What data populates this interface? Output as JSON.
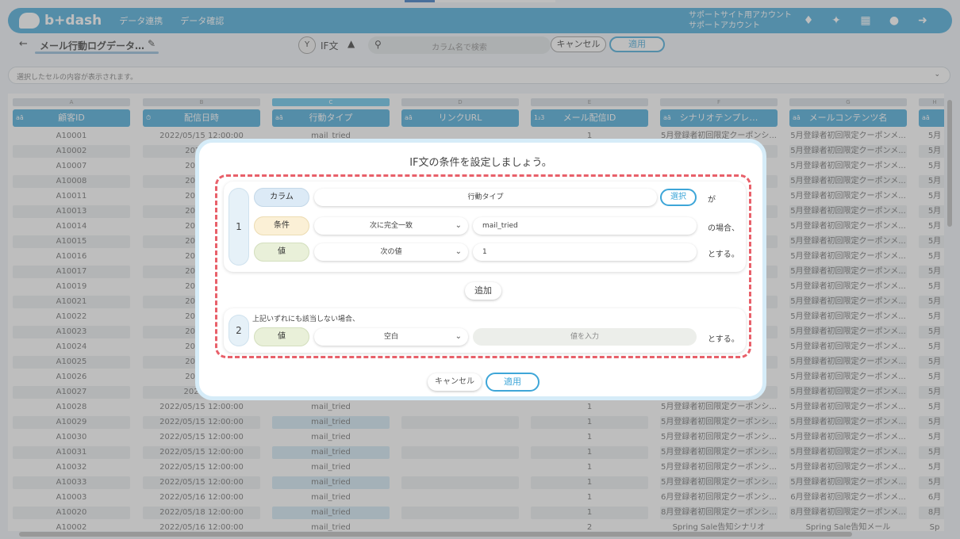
{
  "app": {
    "brand": "b+dash",
    "nav": [
      "データ連携",
      "データ確認"
    ],
    "account_line1": "サポートサイト用アカウント",
    "account_line2": "サポートアカウント",
    "accent": "#3ea6d8"
  },
  "toolbar": {
    "back": "←",
    "doc_title": "メール行動ログデータ…",
    "if_label": "IF文",
    "search_placeholder": "カラム名で検索",
    "cancel": "キャンセル",
    "apply": "適用"
  },
  "cellbar": {
    "text": "選択したセルの内容が表示されます。",
    "chevron": "⌄"
  },
  "grid": {
    "columns": [
      {
        "letter": "A",
        "type": "aā",
        "name": "顧客ID"
      },
      {
        "letter": "B",
        "type": "⏱",
        "name": "配信日時"
      },
      {
        "letter": "C",
        "type": "aā",
        "name": "行動タイプ"
      },
      {
        "letter": "D",
        "type": "aā",
        "name": "リンクURL"
      },
      {
        "letter": "E",
        "type": "1₂3",
        "name": "メール配信ID"
      },
      {
        "letter": "F",
        "type": "aā",
        "name": "シナリオテンプレ…"
      },
      {
        "letter": "G",
        "type": "aā",
        "name": "メールコンテンツ名"
      },
      {
        "letter": "H",
        "type": "aā",
        "name": ""
      }
    ],
    "rows": [
      [
        "A10001",
        "2022/05/15 12:00:00",
        "mail_tried",
        "",
        "1",
        "5月登録者初回限定クーポンシ...",
        "5月登録者初回限定クーポンメ...",
        "5月"
      ],
      [
        "A10002",
        "2022/05",
        "",
        "",
        "",
        "...",
        "5月登録者初回限定クーポンメ...",
        "5月"
      ],
      [
        "A10007",
        "2022/05",
        "",
        "",
        "",
        "...",
        "5月登録者初回限定クーポンメ...",
        "5月"
      ],
      [
        "A10008",
        "2022/05",
        "",
        "",
        "",
        "...",
        "5月登録者初回限定クーポンメ...",
        "5月"
      ],
      [
        "A10011",
        "2022/05",
        "",
        "",
        "",
        "...",
        "5月登録者初回限定クーポンメ...",
        "5月"
      ],
      [
        "A10013",
        "2022/05",
        "",
        "",
        "",
        "...",
        "5月登録者初回限定クーポンメ...",
        "5月"
      ],
      [
        "A10014",
        "2022/05",
        "",
        "",
        "",
        "...",
        "5月登録者初回限定クーポンメ...",
        "5月"
      ],
      [
        "A10015",
        "2022/05",
        "",
        "",
        "",
        "...",
        "5月登録者初回限定クーポンメ...",
        "5月"
      ],
      [
        "A10016",
        "2022/05",
        "",
        "",
        "",
        "...",
        "5月登録者初回限定クーポンメ...",
        "5月"
      ],
      [
        "A10017",
        "2022/05",
        "",
        "",
        "",
        "...",
        "5月登録者初回限定クーポンメ...",
        "5月"
      ],
      [
        "A10019",
        "2022/05",
        "",
        "",
        "",
        "...",
        "5月登録者初回限定クーポンメ...",
        "5月"
      ],
      [
        "A10021",
        "2022/05",
        "",
        "",
        "",
        "...",
        "5月登録者初回限定クーポンメ...",
        "5月"
      ],
      [
        "A10022",
        "2022/05",
        "",
        "",
        "",
        "...",
        "5月登録者初回限定クーポンメ...",
        "5月"
      ],
      [
        "A10023",
        "2022/05",
        "",
        "",
        "",
        "...",
        "5月登録者初回限定クーポンメ...",
        "5月"
      ],
      [
        "A10024",
        "2022/05",
        "",
        "",
        "",
        "...",
        "5月登録者初回限定クーポンメ...",
        "5月"
      ],
      [
        "A10025",
        "2022/05",
        "",
        "",
        "",
        "...",
        "5月登録者初回限定クーポンメ...",
        "5月"
      ],
      [
        "A10026",
        "2022/05",
        "",
        "",
        "",
        "...",
        "5月登録者初回限定クーポンメ...",
        "5月"
      ],
      [
        "A10027",
        "2022/05/",
        "",
        "",
        "",
        "...",
        "5月登録者初回限定クーポンメ...",
        "5月"
      ],
      [
        "A10028",
        "2022/05/15 12:00:00",
        "mail_tried",
        "",
        "1",
        "5月登録者初回限定クーポンシ...",
        "5月登録者初回限定クーポンメ...",
        "5月"
      ],
      [
        "A10029",
        "2022/05/15 12:00:00",
        "mail_tried",
        "",
        "1",
        "5月登録者初回限定クーポンシ...",
        "5月登録者初回限定クーポンメ...",
        "5月"
      ],
      [
        "A10030",
        "2022/05/15 12:00:00",
        "mail_tried",
        "",
        "1",
        "5月登録者初回限定クーポンシ...",
        "5月登録者初回限定クーポンメ...",
        "5月"
      ],
      [
        "A10031",
        "2022/05/15 12:00:00",
        "mail_tried",
        "",
        "1",
        "5月登録者初回限定クーポンシ...",
        "5月登録者初回限定クーポンメ...",
        "5月"
      ],
      [
        "A10032",
        "2022/05/15 12:00:00",
        "mail_tried",
        "",
        "1",
        "5月登録者初回限定クーポンシ...",
        "5月登録者初回限定クーポンメ...",
        "5月"
      ],
      [
        "A10033",
        "2022/05/15 12:00:00",
        "mail_tried",
        "",
        "1",
        "5月登録者初回限定クーポンシ...",
        "5月登録者初回限定クーポンメ...",
        "5月"
      ],
      [
        "A10003",
        "2022/05/16 12:00:00",
        "mail_tried",
        "",
        "1",
        "6月登録者初回限定クーポンシ...",
        "6月登録者初回限定クーポンメ...",
        "6月"
      ],
      [
        "A10020",
        "2022/05/18 12:00:00",
        "mail_tried",
        "",
        "1",
        "8月登録者初回限定クーポンシ...",
        "8月登録者初回限定クーポンメ...",
        "8月"
      ],
      [
        "A10002",
        "2022/05/16 12:00:00",
        "mail_tried",
        "",
        "2",
        "Spring Sale告知シナリオ",
        "Spring Sale告知メール",
        "Sp"
      ]
    ]
  },
  "modal": {
    "title": "IF文の条件を設定しましょう。",
    "condition": {
      "number": "1",
      "column_label": "カラム",
      "column_value": "行動タイプ",
      "select_button": "選択",
      "suffix_column": "が",
      "condition_label": "条件",
      "condition_op": "次に完全一致",
      "condition_value": "mail_tried",
      "suffix_condition": "の場合、",
      "value_label": "値",
      "value_type": "次の値",
      "value_value": "1",
      "suffix_value": "とする。"
    },
    "add_button": "追加",
    "else": {
      "number": "2",
      "text": "上記いずれにも該当しない場合、",
      "value_label": "値",
      "value_type": "空白",
      "value_placeholder": "値を入力",
      "suffix": "とする。"
    },
    "cancel": "キャンセル",
    "apply": "適用"
  }
}
